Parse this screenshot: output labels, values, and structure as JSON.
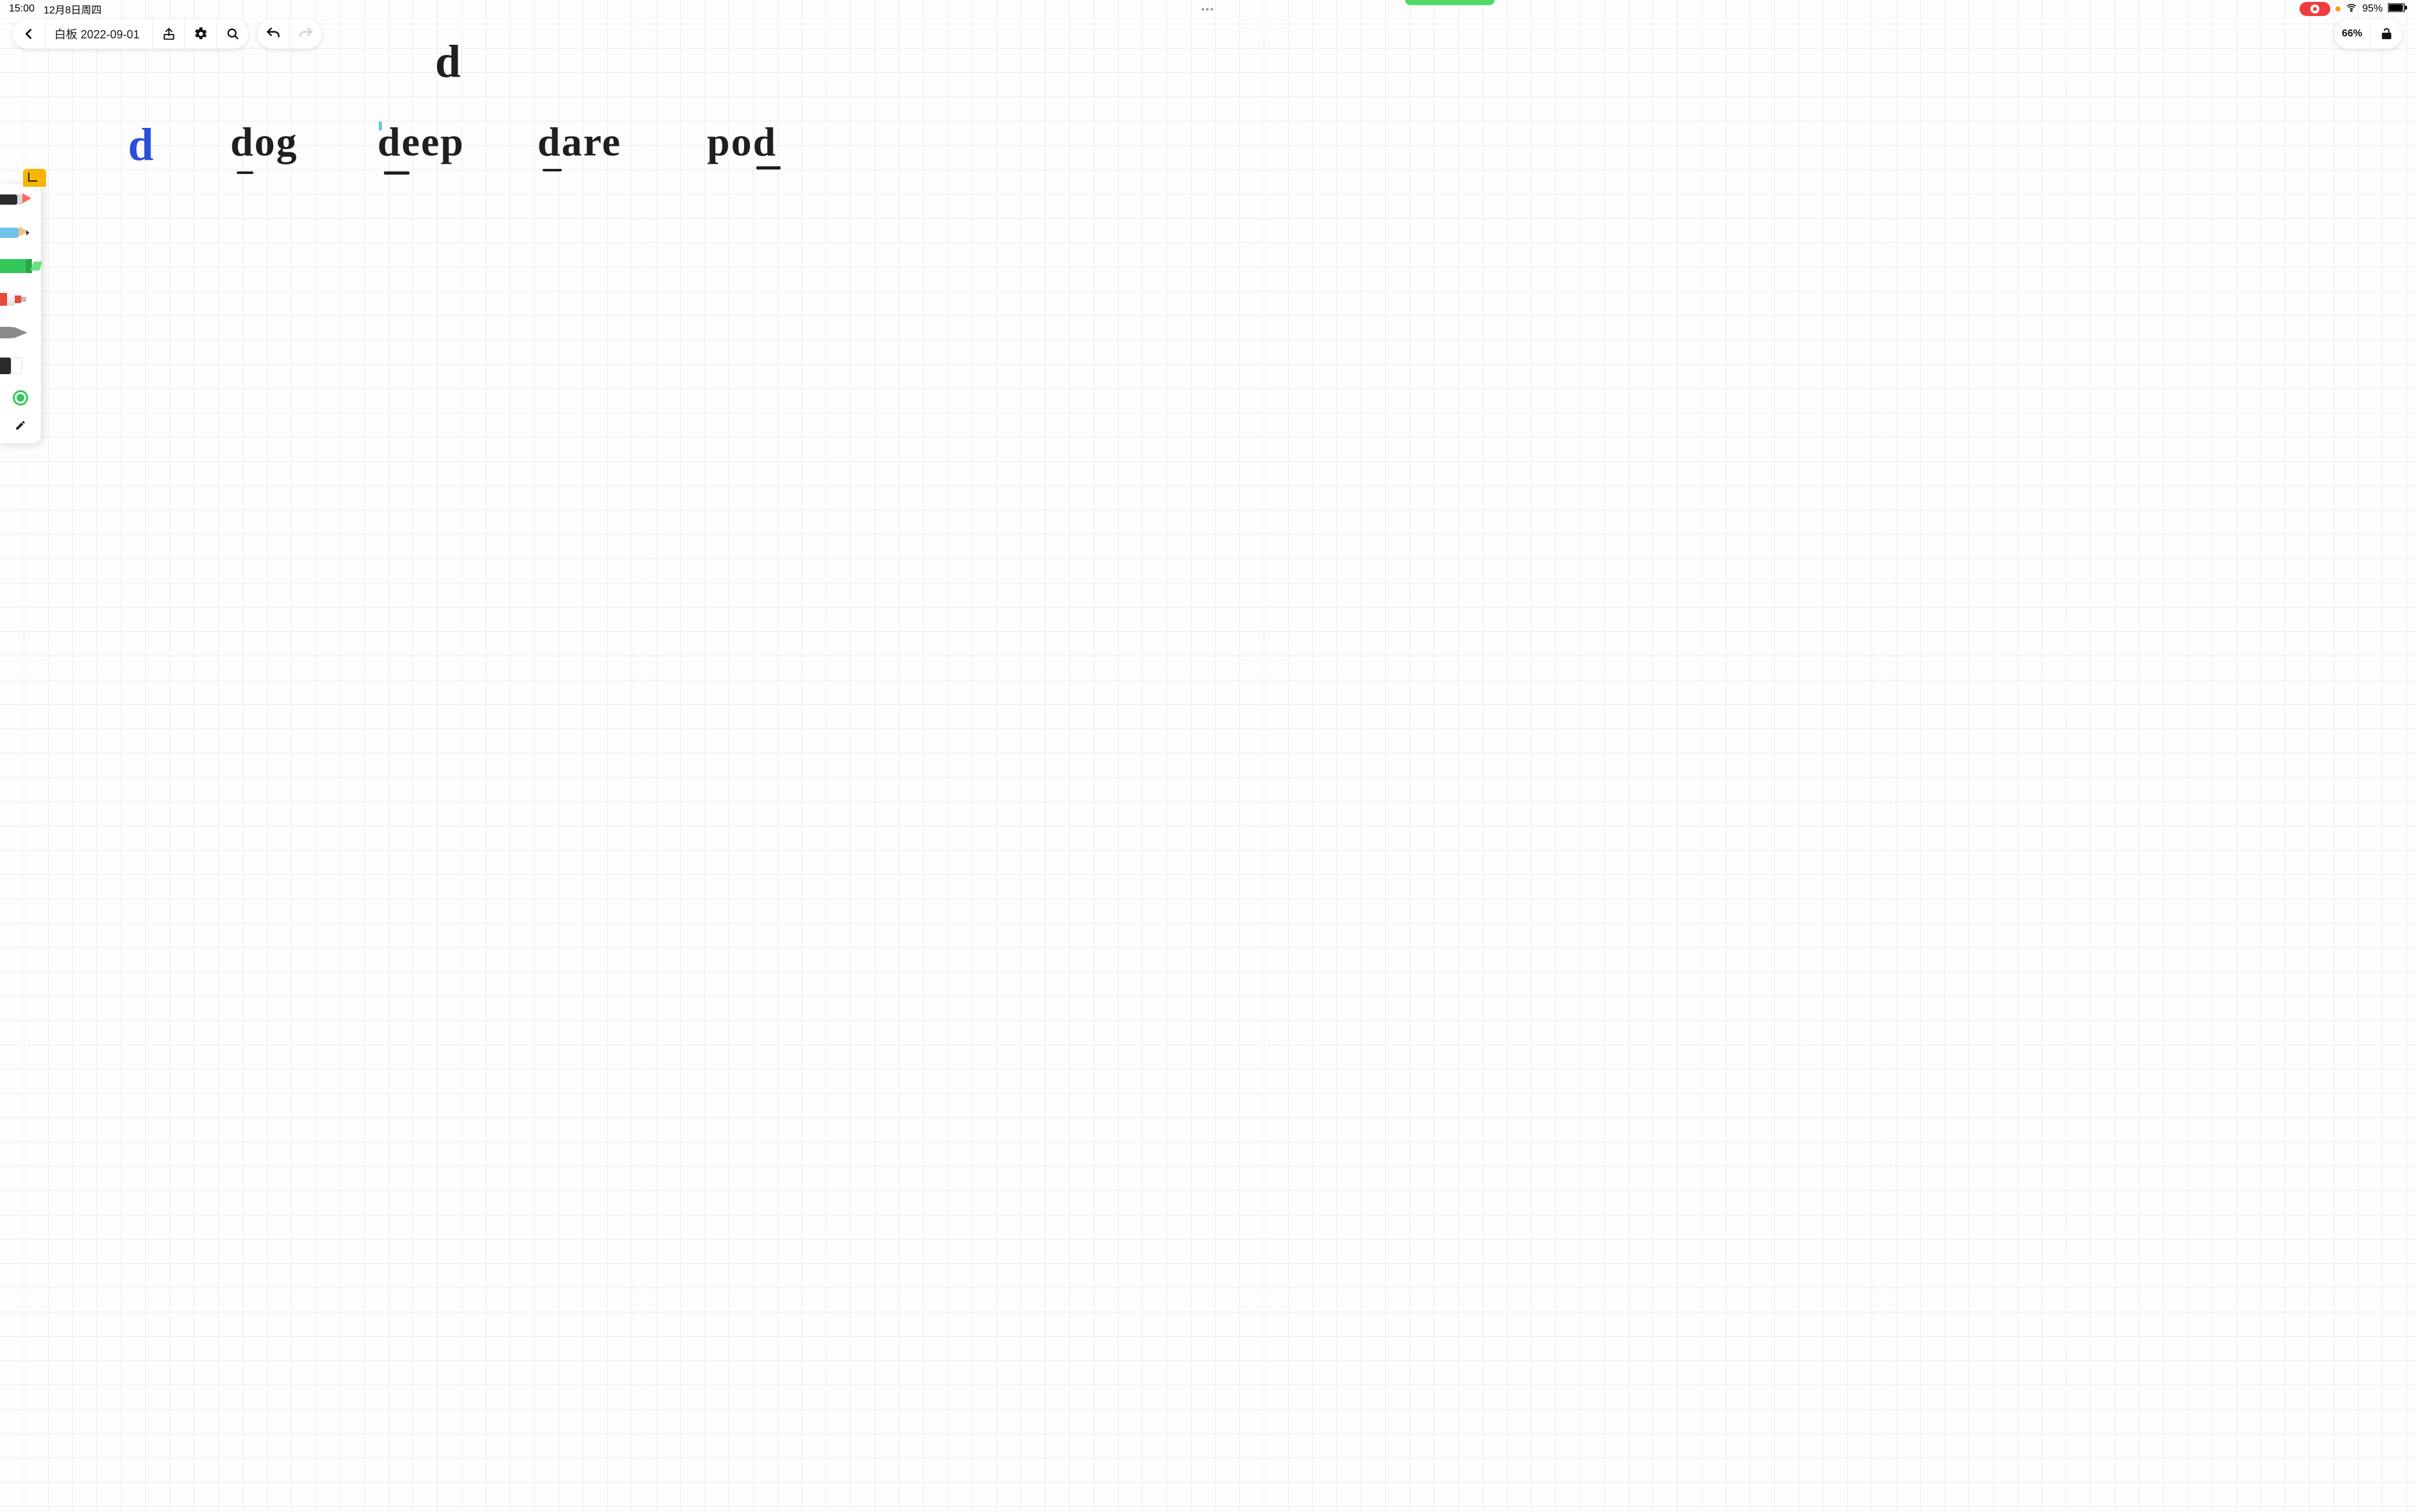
{
  "status_bar": {
    "time": "15:00",
    "date": "12月8日周四",
    "ellipsis": "•••",
    "battery_percent": "95%"
  },
  "toolbar": {
    "document_title": "白板 2022-09-01"
  },
  "right_bar": {
    "zoom": "66%"
  },
  "handwriting": {
    "top_letter": "d",
    "blue_letter": "d",
    "word1": "dog",
    "word2": "deep",
    "word3": "dare",
    "word4": "pod"
  },
  "palette": {
    "tools": [
      {
        "name": "fine-pen",
        "body_color": "#2c2c2c",
        "tip_color": "#ff6a5b"
      },
      {
        "name": "pencil",
        "body_color": "#6fc3e8",
        "tip_color": "#f2c28b"
      },
      {
        "name": "highlighter",
        "body_color": "#34c759",
        "tip_color": "#6adf7f",
        "selected": true
      },
      {
        "name": "paint-tube",
        "body_color": "#e84b3a",
        "tip_color": "#cccccc"
      },
      {
        "name": "brush",
        "body_color": "#8a8a8a",
        "tip_color": "#8a8a8a"
      },
      {
        "name": "eraser",
        "body_color": "#2b2b2b",
        "tip_color": "#ffffff"
      }
    ],
    "current_color": "#34c759"
  },
  "colors": {
    "record_pill": "#ef3b3b",
    "accent_green": "#4cd964"
  }
}
